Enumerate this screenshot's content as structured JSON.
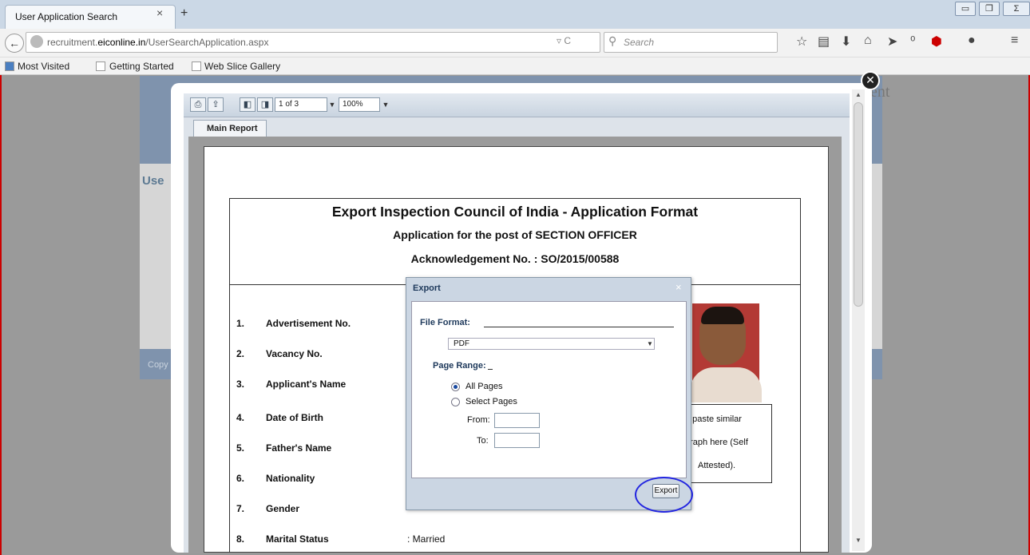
{
  "browser": {
    "tab_title": "User Application Search",
    "tab_close": "×",
    "new_tab": "+",
    "url_prefix": "recruitment.",
    "url_domain": "eiconline.in",
    "url_path": "/UserSearchApplication.aspx",
    "search_placeholder": "Search",
    "bookmarks": [
      "Most Visited",
      "Getting Started",
      "Web Slice Gallery"
    ]
  },
  "background_page": {
    "section_title": "Use",
    "header_fragment": "ent",
    "footer_text": "Copy"
  },
  "report_viewer": {
    "page_indicator": "1 of 3",
    "zoom": "100%",
    "tab_label": "Main Report"
  },
  "report": {
    "title": "Export Inspection Council of India - Application Format",
    "subtitle": "Application for the post of SECTION OFFICER",
    "acknowledgement": "Acknowledgement No. : SO/2015/00588",
    "fields": [
      {
        "num": "1.",
        "label": "Advertisement No.",
        "value": ""
      },
      {
        "num": "2.",
        "label": "Vacancy No.",
        "value": ""
      },
      {
        "num": "3.",
        "label": "Applicant's Name",
        "value": ""
      },
      {
        "num": "4.",
        "label": "Date of Birth",
        "value": ""
      },
      {
        "num": "5.",
        "label": "Father's Name",
        "value": ""
      },
      {
        "num": "6.",
        "label": "Nationality",
        "value": ""
      },
      {
        "num": "7.",
        "label": "Gender",
        "value": ""
      },
      {
        "num": "8.",
        "label": "Marital Status",
        "value": ": Married"
      }
    ],
    "photo_note": [
      "e paste  similar",
      "graph here (Self",
      "Attested)."
    ]
  },
  "export_dialog": {
    "title": "Export",
    "close": "×",
    "file_format_label": "File Format:",
    "format_value": "PDF",
    "page_range_label": "Page Range:",
    "option_all": "All Pages",
    "option_select": "Select Pages",
    "from_label": "From:",
    "to_label": "To:",
    "export_button": "Export"
  }
}
